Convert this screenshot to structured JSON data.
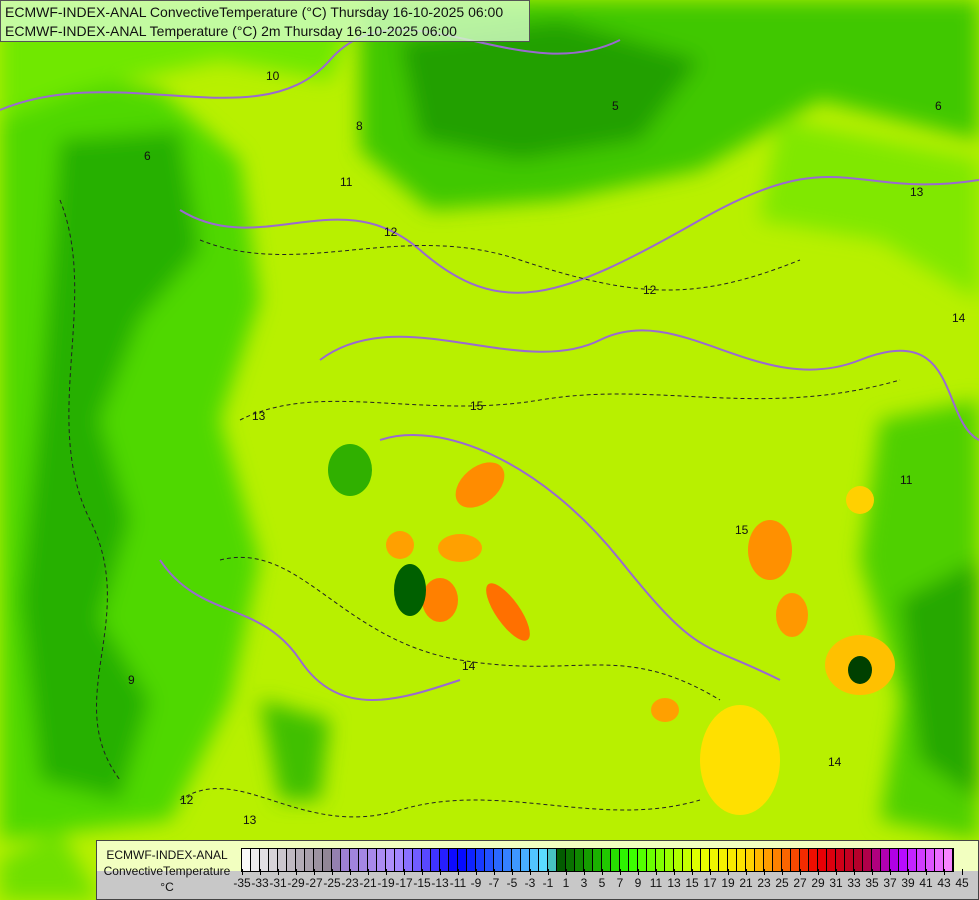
{
  "title": {
    "line1": "ECMWF-INDEX-ANAL ConvectiveTemperature (°C) Thursday 16-10-2025 06:00",
    "line2": "ECMWF-INDEX-ANAL Temperature (°C) 2m Thursday 16-10-2025 06:00"
  },
  "legend": {
    "model": "ECMWF-INDEX-ANAL",
    "parameter": "ConvectiveTemperature",
    "unit": "°C",
    "range": [
      -35,
      45
    ],
    "tick_labels": [
      "-35",
      "-33",
      "-31",
      "-29",
      "-27",
      "-25",
      "-23",
      "-21",
      "-19",
      "-17",
      "-15",
      "-13",
      "-11",
      "-9",
      "-7",
      "-5",
      "-3",
      "-1",
      "1",
      "3",
      "5",
      "7",
      "9",
      "11",
      "13",
      "15",
      "17",
      "19",
      "21",
      "23",
      "25",
      "27",
      "29",
      "31",
      "33",
      "35",
      "37",
      "39",
      "41",
      "43",
      "45"
    ],
    "color_stops": [
      {
        "v": -35,
        "c": "#ffffff"
      },
      {
        "v": -25,
        "c": "#8c8090"
      },
      {
        "v": -24,
        "c": "#9c80d0"
      },
      {
        "v": -18,
        "c": "#b090ff"
      },
      {
        "v": -11,
        "c": "#0000ff"
      },
      {
        "v": -1,
        "c": "#60e8ff"
      },
      {
        "v": 1,
        "c": "#005000"
      },
      {
        "v": 9,
        "c": "#30ff00"
      },
      {
        "v": 17,
        "c": "#e8ff00"
      },
      {
        "v": 22,
        "c": "#ffe000"
      },
      {
        "v": 25,
        "c": "#ff9000"
      },
      {
        "v": 30,
        "c": "#ee0000"
      },
      {
        "v": 35,
        "c": "#b00030"
      },
      {
        "v": 39,
        "c": "#b000ff"
      },
      {
        "v": 45,
        "c": "#ff90ff"
      }
    ]
  },
  "contour_labels": [
    "12",
    "13",
    "15",
    "14",
    "12",
    "13",
    "14",
    "13",
    "12",
    "9",
    "11",
    "15",
    "6",
    "10",
    "14",
    "8",
    "11",
    "6",
    "5"
  ]
}
